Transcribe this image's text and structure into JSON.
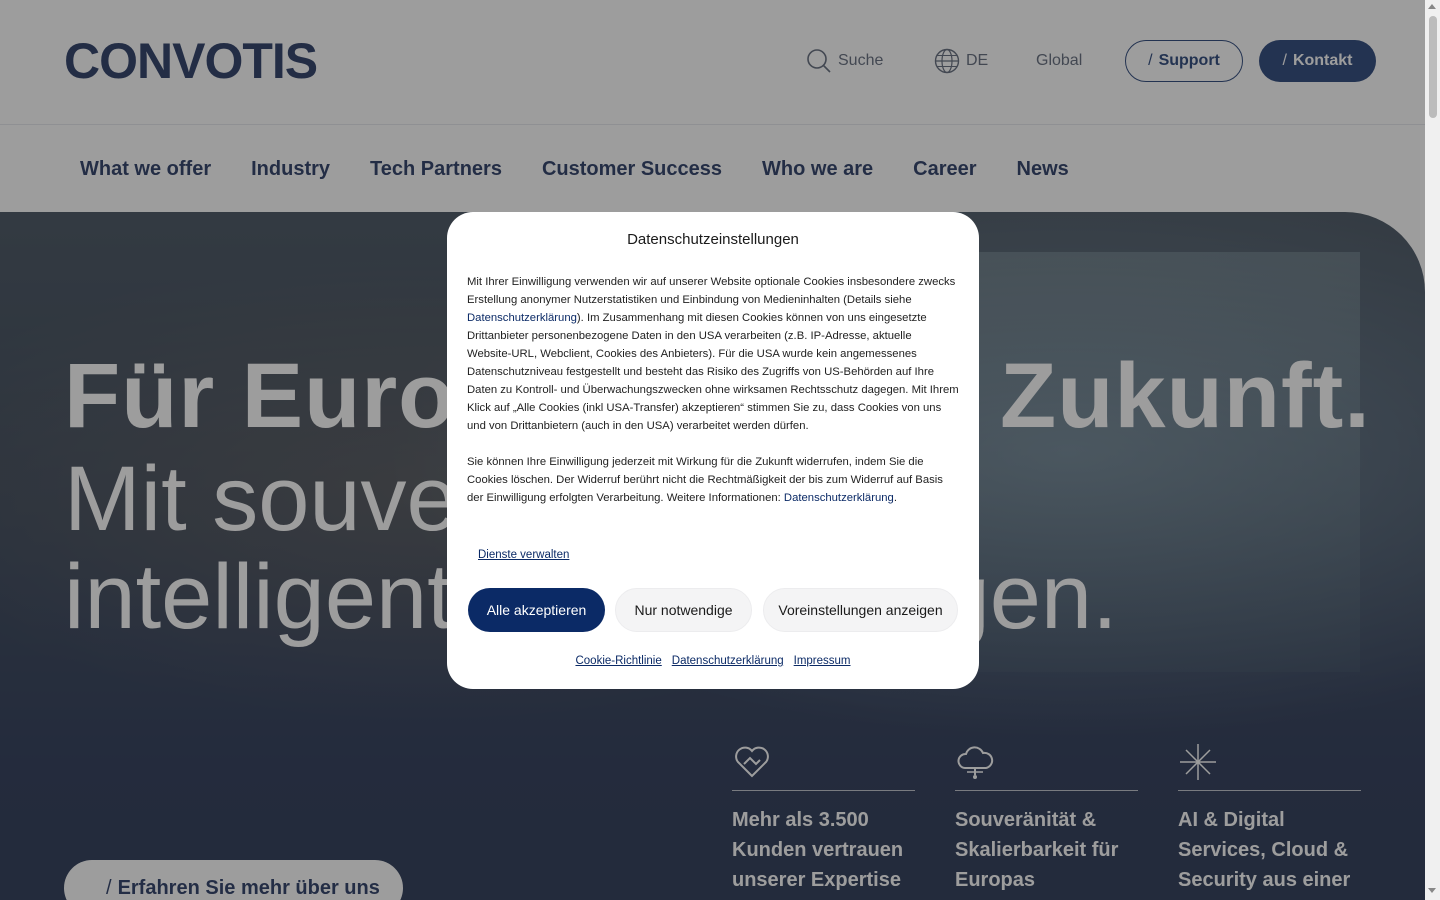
{
  "header": {
    "logo": "CONVOTIS",
    "search_label": "Suche",
    "lang_label": "DE",
    "global_label": "Global",
    "support_label": "Support",
    "kontakt_label": "Kontakt"
  },
  "nav": {
    "items": [
      "What we offer",
      "Industry",
      "Tech Partners",
      "Customer Success",
      "Who we are",
      "Career",
      "News"
    ]
  },
  "hero": {
    "title": "Für Europas digitale Zukunft.",
    "subtitle": "Mit souveränen und intelligenten IT-Lösungen.",
    "cta": "Erfahren Sie mehr über uns",
    "features": [
      {
        "icon": "heart-handshake-icon",
        "text": "Mehr als 3.500 Kunden vertrauen unserer Expertise"
      },
      {
        "icon": "cloud-icon",
        "text": "Souveränität & Skalierbarkeit für Europas"
      },
      {
        "icon": "sparkle-icon",
        "text": "AI & Digital Services, Cloud & Security aus einer"
      }
    ]
  },
  "modal": {
    "title": "Datenschutzeinstellungen",
    "p1_a": "Mit Ihrer Einwilligung verwenden wir auf unserer Website optionale Cookies insbesondere zwecks Erstellung anonymer Nutzerstatistiken und Einbindung von Medieninhalten (Details siehe ",
    "p1_link": "Datenschutzerklärung",
    "p1_b": "). Im Zusammenhang mit diesen Cookies können von uns eingesetzte Drittanbieter personenbezogene Daten in den USA verarbeiten (z.B. IP-Adresse, aktuelle Website-URL, Webclient, Cookies des Anbieters). Für die USA wurde kein angemessenes Datenschutzniveau festgestellt und besteht das Risiko des Zugriffs von US-Behörden auf Ihre Daten zu Kontroll- und Überwachungszwecken ohne wirksamen Rechtsschutz dagegen. Mit Ihrem Klick auf „Alle Cookies (inkl USA-Transfer) akzeptieren“ stimmen Sie zu, dass Cookies von uns und von Drittanbietern (auch in den USA) verarbeitet werden dürfen.",
    "p2_a": "Sie können Ihre Einwilligung jederzeit mit Wirkung für die Zukunft widerrufen, indem Sie die Cookies löschen. Der Widerruf berührt nicht die Rechtmäßigkeit der bis zum Widerruf auf Basis der Einwilligung erfolgten Verarbeitung. Weitere Informationen: ",
    "p2_link": "Datenschutzerklärung",
    "p2_b": ".",
    "manage_label": "Dienste verwalten",
    "accept_label": "Alle akzeptieren",
    "needed_label": "Nur notwendige",
    "prefs_label": "Voreinstellungen anzeigen",
    "footer_links": [
      "Cookie-Richtlinie",
      "Datenschutzerklärung",
      "Impressum"
    ]
  },
  "colors": {
    "brand_navy": "#0b2a66",
    "text_dark": "#0b1f4f"
  }
}
